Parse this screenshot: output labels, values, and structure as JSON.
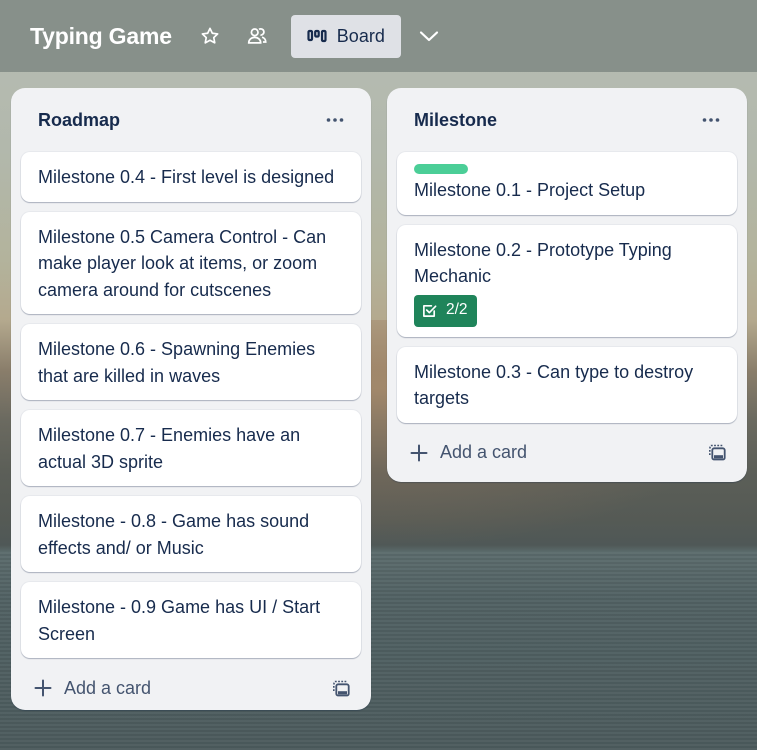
{
  "board": {
    "title": "Typing Game",
    "view_label": "Board",
    "view_icon_glyph": "0 0 °"
  },
  "lists": [
    {
      "title": "Roadmap",
      "cards": [
        {
          "title": "Milestone 0.4 - First level is designed"
        },
        {
          "title": "Milestone 0.5 Camera Control - Can make player look at items, or zoom camera around for cutscenes"
        },
        {
          "title": "Milestone 0.6 - Spawning Enemies that are killed in waves"
        },
        {
          "title": "Milestone 0.7 - Enemies have an actual 3D sprite"
        },
        {
          "title": "Milestone - 0.8 - Game has sound effects and/ or Music"
        },
        {
          "title": "Milestone - 0.9 Game has UI / Start Screen"
        }
      ],
      "add_card_label": "Add a card"
    },
    {
      "title": "Milestone",
      "cards": [
        {
          "title": "Milestone 0.1 - Project Setup",
          "label_color": "#4bce97"
        },
        {
          "title": "Milestone 0.2 - Prototype Typing Mechanic",
          "checklist": "2/2",
          "checklist_color": "#1f845a"
        },
        {
          "title": "Milestone 0.3 - Can type to destroy targets"
        }
      ],
      "add_card_label": "Add a card"
    }
  ]
}
